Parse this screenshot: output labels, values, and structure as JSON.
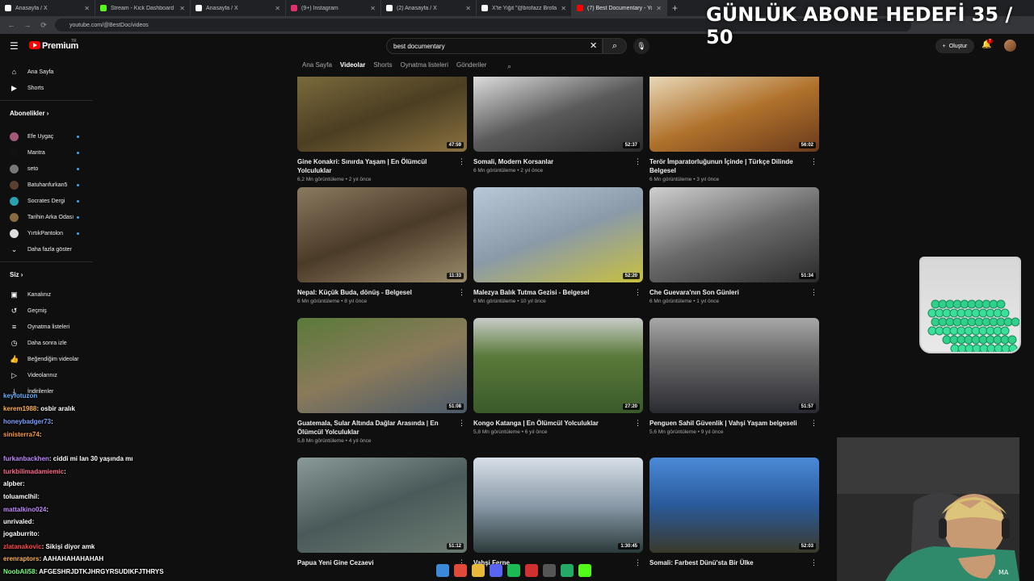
{
  "browser": {
    "tabs": [
      {
        "title": "Anasayfa / X",
        "color": "#ffffff"
      },
      {
        "title": "Stream - Kick Dashboard",
        "color": "#53fc18"
      },
      {
        "title": "Anasayfa / X",
        "color": "#ffffff"
      },
      {
        "title": "(9+) Instagram",
        "color": "#e1306c"
      },
      {
        "title": "(2) Anasayfa / X",
        "color": "#ffffff"
      },
      {
        "title": "X'te Yiğit \"@brofazz Brofaz",
        "color": "#ffffff"
      },
      {
        "title": "(7) Best Documentary - YouTub",
        "color": "#ff0000"
      }
    ],
    "new_tab": "+",
    "url": "youtube.com/@BestDoc/videos"
  },
  "overlay": {
    "goal_text": "GÜNLÜK ABONE HEDEFİ 35 / 50"
  },
  "header": {
    "brand": "Premium",
    "country": "TR",
    "search_value": "best documentary",
    "create_label": "Oluştur",
    "notification_count": "7"
  },
  "sidebar": {
    "main": [
      {
        "label": "Ana Sayfa",
        "icon": "home-icon"
      },
      {
        "label": "Shorts",
        "icon": "shorts-icon"
      }
    ],
    "subs_heading": "Abonelikler",
    "subs": [
      {
        "label": "Efe Uygaç",
        "color": "#a35a7a"
      },
      {
        "label": "Mantra",
        "color": "#111111"
      },
      {
        "label": "seto",
        "color": "#777777"
      },
      {
        "label": "Batuhanfurkan5",
        "color": "#5a4030"
      },
      {
        "label": "Socrates Dergi",
        "color": "#2aa0b0"
      },
      {
        "label": "Tarihin Arka Odası",
        "color": "#8a6a40"
      },
      {
        "label": "YırtıkPantolon",
        "color": "#dddddd"
      }
    ],
    "show_more": "Daha fazla göster",
    "you_heading": "Siz",
    "you": [
      {
        "label": "Kanalınız",
        "icon": "channel-icon"
      },
      {
        "label": "Geçmiş",
        "icon": "history-icon"
      },
      {
        "label": "Oynatma listeleri",
        "icon": "playlists-icon"
      },
      {
        "label": "Daha sonra izle",
        "icon": "watch-later-icon"
      },
      {
        "label": "Beğendiğim videolar",
        "icon": "like-icon"
      },
      {
        "label": "Videolarınız",
        "icon": "your-videos-icon"
      },
      {
        "label": "İndirilenler",
        "icon": "download-icon"
      }
    ]
  },
  "channel_tabs": [
    "Ana Sayfa",
    "Videolar",
    "Shorts",
    "Oynatma listeleri",
    "Gönderiler"
  ],
  "videos": [
    {
      "title": "Gine Konakri: Sınırda Yaşam | En Ölümcül Yolculuklar",
      "meta": "6,2 Mn görüntüleme • 2 yıl önce",
      "duration": "47:59",
      "bg": "linear-gradient(160deg,#7a6a3c,#4b3e22 50%,#8a7240)"
    },
    {
      "title": "Somali, Modern Korsanlar",
      "meta": "6 Mn görüntüleme • 2 yıl önce",
      "duration": "52:37",
      "bg": "linear-gradient(160deg,#dcdcdc,#5a5a5a 50%,#2a2a2a)"
    },
    {
      "title": "Terör İmparatorluğunun İçinde | Türkçe Dilinde Belgesel",
      "meta": "6 Mn görüntüleme • 3 yıl önce",
      "duration": "56:02",
      "bg": "linear-gradient(160deg,#e8d8b8,#b0722c 50%,#6a3a1a)"
    },
    {
      "title": "Nepal: Küçük Buda, dönüş - Belgesel",
      "meta": "6 Mn görüntüleme • 8 yıl önce",
      "duration": "11:33",
      "bg": "linear-gradient(160deg,#8a7a60,#4a3a28 50%,#9a8a6a)"
    },
    {
      "title": "Malezya Balık Tutma Gezisi - Belgesel",
      "meta": "6 Mn görüntüleme • 10 yıl önce",
      "duration": "52:20",
      "bg": "linear-gradient(160deg,#b8c8d8,#8a9aa8 50%,#c8c040)"
    },
    {
      "title": "Che Guevara'nın Son Günleri",
      "meta": "6 Mn görüntüleme • 1 yıl önce",
      "duration": "51:34",
      "bg": "linear-gradient(160deg,#d0d0d0,#6a6a6a 50%,#2a2a2a)"
    },
    {
      "title": "Guatemala, Sular Altında Dağlar Arasında | En Ölümcül Yolculuklar",
      "meta": "5,8 Mn görüntüleme • 4 yıl önce",
      "duration": "51:08",
      "bg": "linear-gradient(160deg,#5a7a3a,#8a7a5a 50%,#4a5a6a)"
    },
    {
      "title": "Kongo Katanga | En Ölümcül Yolculuklar",
      "meta": "5,8 Mn görüntüleme • 6 yıl önce",
      "duration": "27:20",
      "bg": "linear-gradient(180deg,#c8ccc8,#5a7a3a 40%,#3a5a2a)"
    },
    {
      "title": "Penguen Sahil Güvenlik | Vahşi Yaşam belgeseli",
      "meta": "5,6 Mn görüntüleme • 9 yıl önce",
      "duration": "51:57",
      "bg": "linear-gradient(180deg,#a8a8a8,#6a6a6a 40%,#2a2a32)"
    },
    {
      "title": "Papua Yeni Gine Cezaevi",
      "meta": "",
      "duration": "51:12",
      "bg": "linear-gradient(160deg,#8a9a98,#4a5a5a 50%,#6a7a70)"
    },
    {
      "title": "Vahşi Ferne",
      "meta": "",
      "duration": "1:30:45",
      "bg": "linear-gradient(180deg,#d8e0e8,#8a9aa8 50%,#2a3a3a)"
    },
    {
      "title": "Somali: Farbest Dünü'sta Bir Ülke",
      "meta": "",
      "duration": "52:03",
      "bg": "linear-gradient(180deg,#4a8ad8,#2a5a9a 50%,#3a3a2a)"
    }
  ],
  "chat": [
    {
      "user": "keyfotuzon",
      "msg": "",
      "color": "#6ab0ff"
    },
    {
      "user": "kerem1988",
      "msg": ": osbir aralık",
      "color": "#ffb347"
    },
    {
      "user": "honeybadger73",
      "msg": ":",
      "color": "#7aa0ff"
    },
    {
      "user": "sinisterra74",
      "msg": ":",
      "color": "#ff9a3a"
    },
    {
      "user": "furkanbackhen",
      "msg": ": ciddi mi lan 30 yaşında mı",
      "color": "#c08aff"
    },
    {
      "user": "turkbilimadamiemic",
      "msg": ":",
      "color": "#ff6a8a"
    },
    {
      "user": "alpber",
      "msg": ":",
      "color": "#ffffff"
    },
    {
      "user": "toluamclhil",
      "msg": ":",
      "color": "#ffffff"
    },
    {
      "user": "mattalkino024",
      "msg": ":",
      "color": "#c08aff"
    },
    {
      "user": "unrivaled",
      "msg": ":",
      "color": "#ffffff"
    },
    {
      "user": "jogaburrito",
      "msg": ":",
      "color": "#ffffff"
    },
    {
      "user": "zlatanakovic",
      "msg": ": Sikişi diyor amk",
      "color": "#ff4a4a"
    },
    {
      "user": "erenraptors",
      "msg": ": AAHAHAHAHAHAH",
      "color": "#ffb347"
    },
    {
      "user": "NoobAli58",
      "msg": ": AFGESHRJDTKJHRGYRSUDIKFJTHRYS",
      "color": "#7aff7a"
    }
  ],
  "taskbar": [
    {
      "icon": "windows-icon",
      "color": "#3a8ad8"
    },
    {
      "icon": "chrome-icon",
      "color": "#e04a3a"
    },
    {
      "icon": "folder-icon",
      "color": "#e8b83a"
    },
    {
      "icon": "discord-icon",
      "color": "#5865f2"
    },
    {
      "icon": "spotify-icon",
      "color": "#1db954"
    },
    {
      "icon": "x-app-icon",
      "color": "#d03030"
    },
    {
      "icon": "calculator-icon",
      "color": "#555555"
    },
    {
      "icon": "app-icon",
      "color": "#22aa66"
    },
    {
      "icon": "kick-icon",
      "color": "#53fc18"
    }
  ]
}
